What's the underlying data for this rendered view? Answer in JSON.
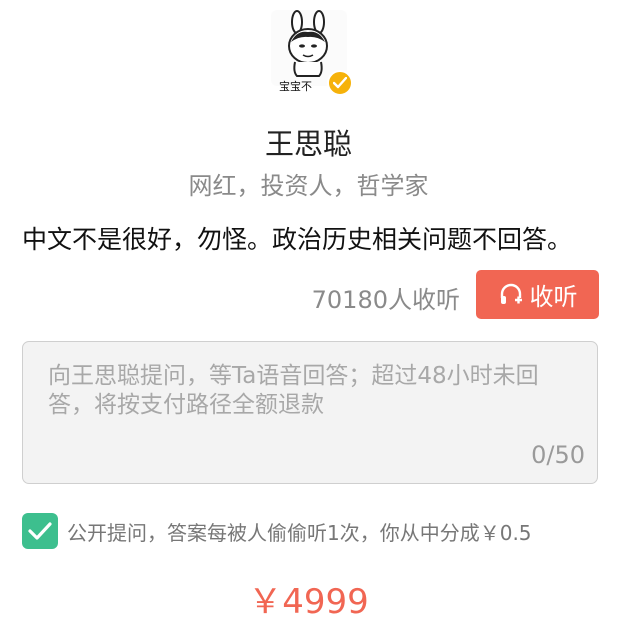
{
  "profile": {
    "avatar_caption": "宝宝不",
    "name": "王思聪",
    "tags": "网红，投资人，哲学家",
    "bio": "中文不是很好，勿怪。政治历史相关问题不回答。"
  },
  "listen": {
    "count_text": "70180人收听",
    "button_label": "收听"
  },
  "question": {
    "placeholder": "向王思聪提问，等Ta语音回答；超过48小时未回答，将按支付路径全额退款",
    "counter": "0/50"
  },
  "public_option": {
    "checked": true,
    "label": "公开提问，答案每被人偷偷听1次，你从中分成￥0.5"
  },
  "price": "￥4999",
  "colors": {
    "accent": "#f16653",
    "verified": "#f6b20a",
    "checkbox": "#3dbf8e"
  }
}
